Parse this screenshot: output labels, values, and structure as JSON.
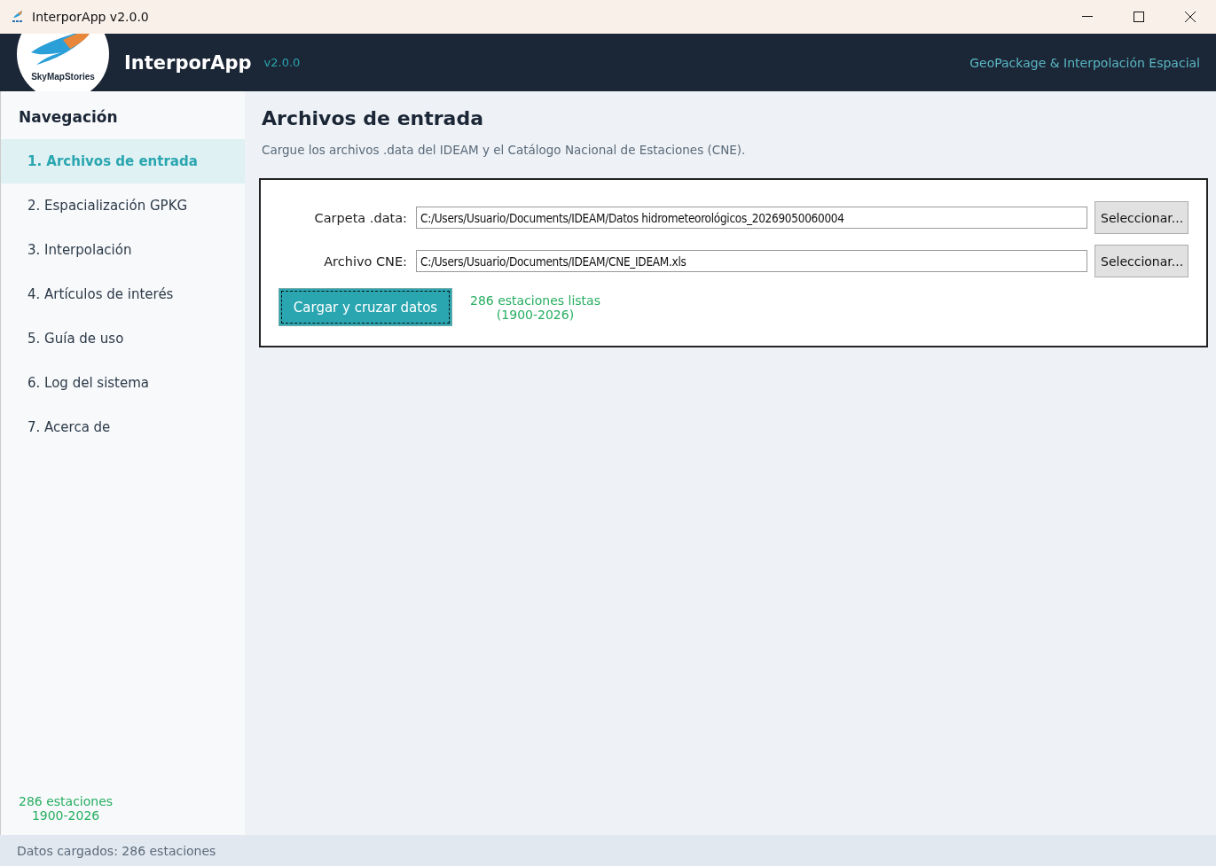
{
  "window": {
    "title": "InterporApp v2.0.0"
  },
  "header": {
    "logo_text": "SkyMapStories",
    "app_name": "InterporApp",
    "version": "v2.0.0",
    "tagline": "GeoPackage & Interpolación Espacial"
  },
  "sidebar": {
    "title": "Navegación",
    "items": [
      {
        "label": "1. Archivos de entrada",
        "selected": true
      },
      {
        "label": "2. Espacialización GPKG",
        "selected": false
      },
      {
        "label": "3. Interpolación",
        "selected": false
      },
      {
        "label": "4. Artículos de interés",
        "selected": false
      },
      {
        "label": "5. Guía de uso",
        "selected": false
      },
      {
        "label": "6. Log del sistema",
        "selected": false
      },
      {
        "label": "7. Acerca de",
        "selected": false
      }
    ],
    "summary": [
      "286 estaciones",
      "1900-2026"
    ]
  },
  "main": {
    "title": "Archivos de entrada",
    "description": "Cargue los archivos .data del IDEAM y el Catálogo Nacional de Estaciones (CNE).",
    "fields": [
      {
        "label": "Carpeta .data:",
        "value": "C:/Users/Usuario/Documents/IDEAM/Datos hidrometeorológicos_20269050060004",
        "button": "Seleccionar..."
      },
      {
        "label": "Archivo CNE:",
        "value": "C:/Users/Usuario/Documents/IDEAM/CNE_IDEAM.xls",
        "button": "Seleccionar..."
      }
    ],
    "action_button": "Cargar y cruzar datos",
    "result": [
      "286 estaciones listas",
      "(1900-2026)"
    ]
  },
  "status_bar": "Datos cargados: 286 estaciones"
}
